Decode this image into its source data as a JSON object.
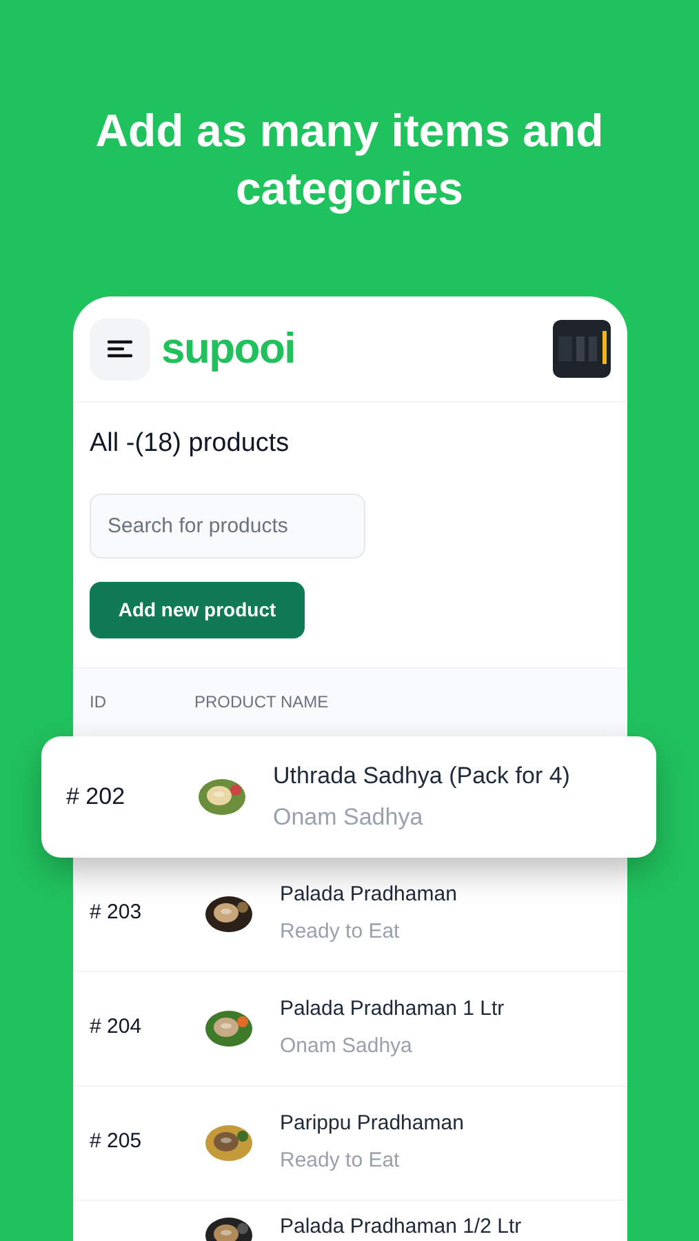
{
  "headline": "Add as many items and categories",
  "app_bar": {
    "logo": "supooi"
  },
  "page_title": "All -(18) products",
  "search": {
    "placeholder": "Search for products"
  },
  "add_button": "Add new product",
  "table": {
    "columns": [
      "ID",
      "PRODUCT NAME"
    ],
    "rows": [
      {
        "id": "# 202",
        "name": "Uthrada Sadhya (Pack for 4)",
        "category": "Onam Sadhya",
        "raised": true
      },
      {
        "id": "# 203",
        "name": "Palada Pradhaman",
        "category": "Ready to Eat",
        "raised": false
      },
      {
        "id": "# 204",
        "name": "Palada Pradhaman 1 Ltr",
        "category": "Onam Sadhya",
        "raised": false
      },
      {
        "id": "# 205",
        "name": "Parippu Pradhaman",
        "category": "Ready to Eat",
        "raised": false
      },
      {
        "name": "Palada Pradhaman 1/2 Ltr",
        "raised": false
      }
    ]
  }
}
